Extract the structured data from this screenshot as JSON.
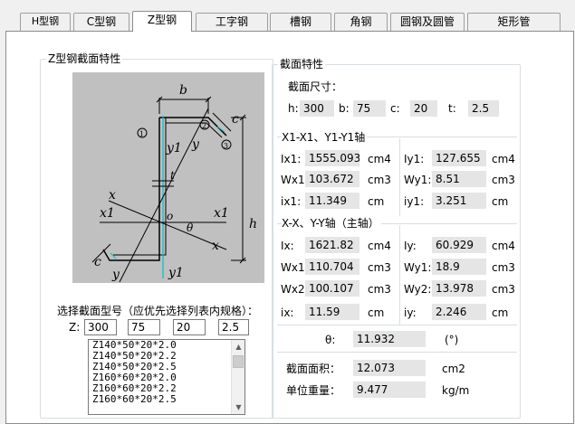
{
  "tabs": [
    {
      "label": "H型钢"
    },
    {
      "label": "C型钢"
    },
    {
      "label": "Z型钢"
    },
    {
      "label": "工字钢"
    },
    {
      "label": "槽钢"
    },
    {
      "label": "角钢"
    },
    {
      "label": "圆钢及圆管"
    },
    {
      "label": "矩形管"
    }
  ],
  "left_group": {
    "title": "Z型钢截面特性",
    "diagram": {
      "b": "b",
      "c": "c",
      "t": "t",
      "h": "h",
      "x": "x",
      "x1": "x1",
      "y": "y",
      "y1": "y1",
      "o": "o",
      "theta": "θ",
      "n1": "1",
      "n2": "2",
      "n3": "3"
    },
    "select_label": "选择截面型号（应优先选择列表内规格）：",
    "z_label": "Z:",
    "z_inputs": [
      "300",
      "75",
      "20",
      "2.5"
    ],
    "list_items": [
      "Z140*50*20*2.0",
      "Z140*50*20*2.2",
      "Z140*50*20*2.5",
      "Z160*60*20*2.0",
      "Z160*60*20*2.2",
      "Z160*60*20*2.5"
    ]
  },
  "right_group": {
    "title": "截面特性",
    "dim_label": "截面尺寸：",
    "dims": [
      {
        "label": "h:",
        "value": "300"
      },
      {
        "label": "b:",
        "value": "75"
      },
      {
        "label": "c:",
        "value": "20"
      },
      {
        "label": "t:",
        "value": "2.5"
      }
    ],
    "axis1_title": "X1-X1、Y1-Y1轴",
    "axis1_rows": [
      {
        "l": "Ix1:",
        "lv": "1555.093",
        "lu": "cm4",
        "r": "Iy1:",
        "rv": "127.655",
        "ru": "cm4"
      },
      {
        "l": "Wx1:",
        "lv": "103.672",
        "lu": "cm3",
        "r": "Wy1:",
        "rv": "8.51",
        "ru": "cm3"
      },
      {
        "l": "ix1:",
        "lv": "11.349",
        "lu": "cm",
        "r": "iy1:",
        "rv": "3.251",
        "ru": "cm"
      }
    ],
    "axis2_title": "X-X、Y-Y轴（主轴）",
    "axis2_rows": [
      {
        "l": "Ix:",
        "lv": "1621.82",
        "lu": "cm4",
        "r": "Iy:",
        "rv": "60.929",
        "ru": "cm4"
      },
      {
        "l": "Wx1:",
        "lv": "110.704",
        "lu": "cm3",
        "r": "Wy1:",
        "rv": "18.9",
        "ru": "cm3"
      },
      {
        "l": "Wx2:",
        "lv": "100.107",
        "lu": "cm3",
        "r": "Wy2:",
        "rv": "13.978",
        "ru": "cm3"
      },
      {
        "l": "ix:",
        "lv": "11.59",
        "lu": "cm",
        "r": "iy:",
        "rv": "2.246",
        "ru": "cm"
      }
    ],
    "theta_label": "θ:",
    "theta_value": "11.932",
    "theta_unit": "(°)",
    "area_label": "截面面积：",
    "area_value": "12.073",
    "area_unit": "cm2",
    "weight_label": "单位重量：",
    "weight_value": "9.477",
    "weight_unit": "kg/m"
  }
}
